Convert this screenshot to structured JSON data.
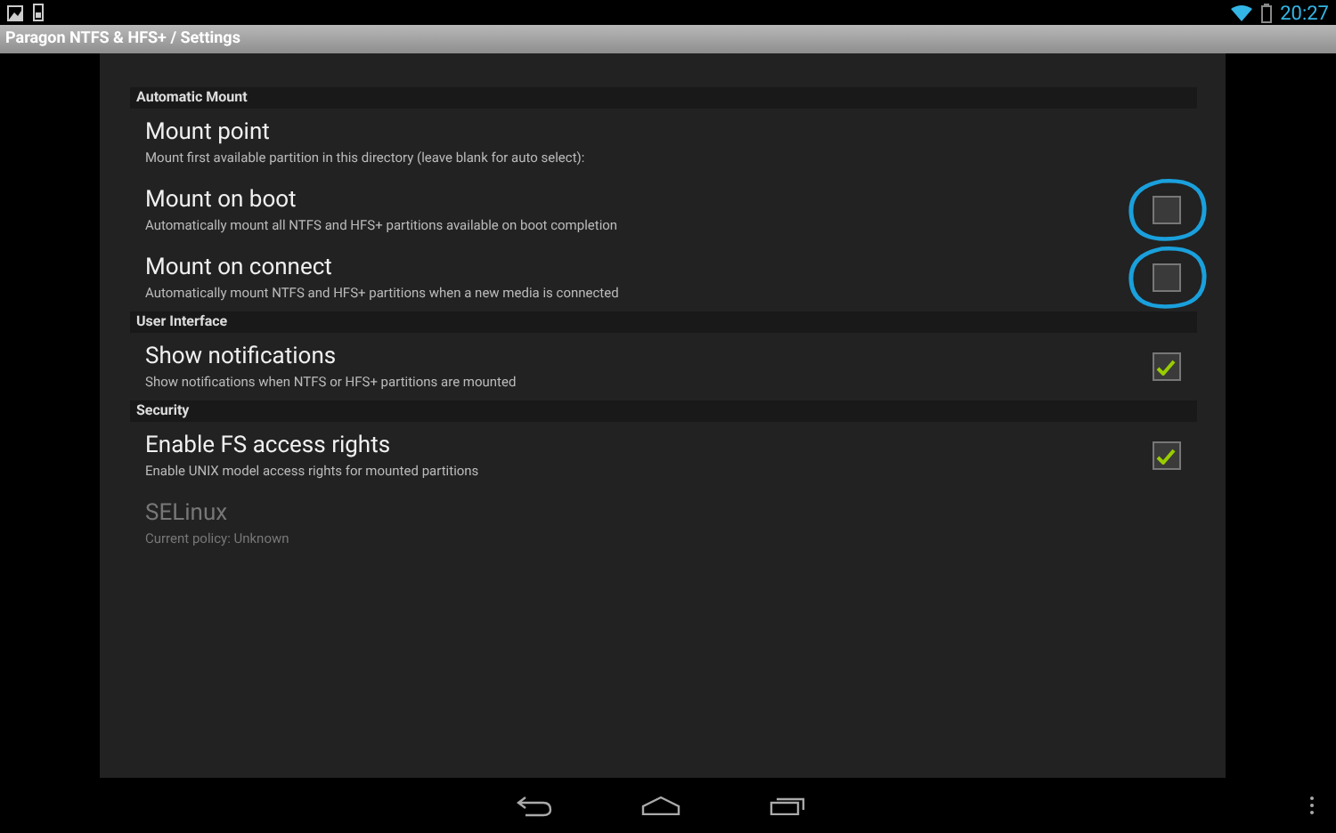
{
  "status_bar": {
    "time": "20:27"
  },
  "title_bar": {
    "title": "Paragon NTFS & HFS+ / Settings"
  },
  "sections": [
    {
      "header": "Automatic Mount",
      "items": [
        {
          "kind": "text",
          "title": "Mount point",
          "summary": "Mount first available partition in this directory (leave blank for auto select):",
          "disabled": false
        },
        {
          "kind": "checkbox",
          "title": "Mount on boot",
          "summary": "Automatically mount all NTFS and HFS+ partitions available on boot completion",
          "checked": false,
          "disabled": false,
          "circled": true
        },
        {
          "kind": "checkbox",
          "title": "Mount on connect",
          "summary": "Automatically mount NTFS and HFS+ partitions when a new media is connected",
          "checked": false,
          "disabled": false,
          "circled": true
        }
      ]
    },
    {
      "header": "User Interface",
      "items": [
        {
          "kind": "checkbox",
          "title": "Show notifications",
          "summary": "Show notifications when NTFS or HFS+ partitions are mounted",
          "checked": true,
          "disabled": false,
          "circled": false
        }
      ]
    },
    {
      "header": "Security",
      "items": [
        {
          "kind": "checkbox",
          "title": "Enable FS access rights",
          "summary": "Enable UNIX model access rights for mounted partitions",
          "checked": true,
          "disabled": false,
          "circled": false
        },
        {
          "kind": "text",
          "title": "SELinux",
          "summary": "Current policy: Unknown",
          "disabled": true
        }
      ]
    }
  ]
}
